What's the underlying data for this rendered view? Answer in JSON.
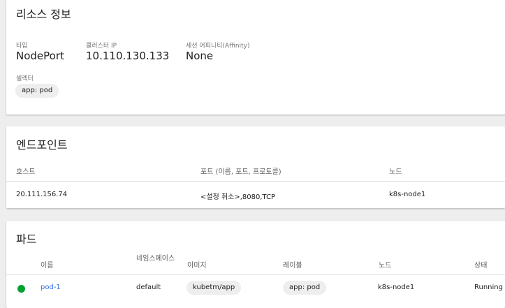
{
  "resource_info": {
    "title": "리소스 정보",
    "type_label": "타입",
    "type_value": "NodePort",
    "cluster_ip_label": "클러스터 IP",
    "cluster_ip_value": "10.110.130.133",
    "affinity_label": "세션 어피니티(Affinity)",
    "affinity_value": "None",
    "selector_label": "셀렉터",
    "selector_chip": "app: pod"
  },
  "endpoints": {
    "title": "엔드포인트",
    "headers": {
      "host": "호스트",
      "ports": "포트 (이름, 포트, 프로토콜)",
      "node": "노드"
    },
    "rows": [
      {
        "host": "20.111.156.74",
        "ports": "<설정 취소>,8080,TCP",
        "node": "k8s-node1"
      }
    ]
  },
  "pods": {
    "title": "파드",
    "headers": {
      "name": "이름",
      "namespace": "네임스페이스",
      "images": "이미지",
      "labels": "레이블",
      "node": "노드",
      "status": "상태"
    },
    "rows": [
      {
        "name": "pod-1",
        "namespace": "default",
        "image": "kubetm/app",
        "label": "app: pod",
        "node": "k8s-node1",
        "status": "Running",
        "status_color": "#00a230"
      }
    ]
  },
  "colors": {
    "link": "#326de6",
    "background": "#eeeeee",
    "card": "#ffffff"
  }
}
